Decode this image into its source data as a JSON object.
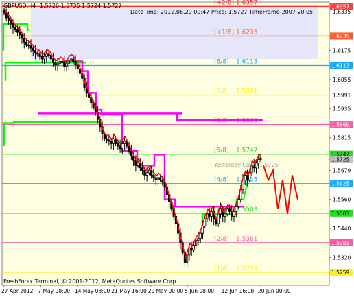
{
  "chart_window": {
    "symbol_label": "GBPUSD,H4",
    "ohlc_values": "1.5726 1.5735 1.5724 1.5727",
    "info_line": "DateTime: 2012.06.20 09:47  Price: 1.5727  TimeFrame-2007-v0.05",
    "copyright": "FreshForex Terminal, © 2001-2012, MetaQuotes Software Corp.",
    "yesterday_close_label": "Yesterday Close 1.5725",
    "colors": {
      "background": "#fefee0",
      "candles": "#000000",
      "red_line": "#ff0000",
      "magenta_line": "#ff00ff",
      "green_line": "#00ff00",
      "lavender_zone": "#e6e6fa"
    }
  },
  "chart_data": {
    "type": "candlestick",
    "symbol": "GBPUSD",
    "timeframe": "H4",
    "ylim": [
      1.5205,
      1.6375
    ],
    "y_ticks": [
      "1.6335",
      "1.6235",
      "1.6175",
      "1.6113",
      "1.6055",
      "1.5991",
      "1.5935",
      "1.5869",
      "1.5815",
      "1.5747",
      "1.5725",
      "1.5679",
      "1.5625",
      "1.5560",
      "1.5503",
      "1.5440",
      "1.5381",
      "1.5320",
      "1.5259"
    ],
    "x_ticks": [
      "27 Apr 2012",
      "7 May 00:00",
      "14 May 08:00",
      "21 May 16:00",
      "29 May 00:00",
      "5 Jun 08:00",
      "12 Jun 16:00",
      "20 Jun 00:00"
    ],
    "murrey_levels": [
      {
        "label": "[+2/8]",
        "value": 1.6357,
        "price_text": "1.6357",
        "color": "#ff3030"
      },
      {
        "label": "[+1/8]",
        "value": 1.6235,
        "price_text": "1.6235",
        "color": "#ff6a2a"
      },
      {
        "label": "[8/8]",
        "value": 1.6113,
        "price_text": "1.6113",
        "color": "#1aaaff"
      },
      {
        "label": "[7/8]",
        "value": 1.5991,
        "price_text": "1.5991",
        "color": "#ffee22"
      },
      {
        "label": "[6/8]",
        "value": 1.5869,
        "price_text": "1.5869",
        "color": "#ff5aa8"
      },
      {
        "label": "[5/8]",
        "value": 1.5747,
        "price_text": "1.5747",
        "color": "#22dd22"
      },
      {
        "label": "[4/8]",
        "value": 1.5625,
        "price_text": "1.5625",
        "color": "#1aaaff"
      },
      {
        "label": "[3/8]",
        "value": 1.5503,
        "price_text": "1.5503",
        "color": "#22dd22"
      },
      {
        "label": "[2/8]",
        "value": 1.5381,
        "price_text": "1.5381",
        "color": "#ff5aa8"
      },
      {
        "label": "[1/8]",
        "value": 1.5259,
        "price_text": "1.5259",
        "color": "#ffee22"
      }
    ],
    "price_badges": [
      {
        "value": 1.6357,
        "text": "1.6357",
        "bg": "#ff4040",
        "fg": "#ffffff"
      },
      {
        "value": 1.6235,
        "text": "1.6235",
        "bg": "#ff5a2a",
        "fg": "#ffffff"
      },
      {
        "value": 1.6113,
        "text": "1.6113",
        "bg": "#1aaaff",
        "fg": "#ffffff"
      },
      {
        "value": 1.5869,
        "text": "1.5869",
        "bg": "#ff5aa8",
        "fg": "#ffffff"
      },
      {
        "value": 1.5747,
        "text": "1.5747",
        "bg": "#22dd22",
        "fg": "#000000"
      },
      {
        "value": 1.5725,
        "text": "1.5725",
        "bg": "#c0c0c0",
        "fg": "#000000"
      },
      {
        "value": 1.5625,
        "text": "1.5625",
        "bg": "#1aaaff",
        "fg": "#ffffff"
      },
      {
        "value": 1.5503,
        "text": "1.5503",
        "bg": "#22dd22",
        "fg": "#000000"
      },
      {
        "value": 1.5381,
        "text": "1.5381",
        "bg": "#ff5aa8",
        "fg": "#ffffff"
      },
      {
        "value": 1.5259,
        "text": "1.5259",
        "bg": "#ffee22",
        "fg": "#000000"
      }
    ],
    "closes": [
      1.633,
      1.631,
      1.63,
      1.6285,
      1.627,
      1.626,
      1.625,
      1.624,
      1.6225,
      1.621,
      1.62,
      1.6195,
      1.6185,
      1.6175,
      1.6165,
      1.616,
      1.615,
      1.614,
      1.615,
      1.616,
      1.6155,
      1.614,
      1.6125,
      1.6115,
      1.612,
      1.613,
      1.6125,
      1.611,
      1.612,
      1.6135,
      1.614,
      1.613,
      1.6115,
      1.61,
      1.608,
      1.606,
      1.602,
      1.6,
      1.598,
      1.596,
      1.594,
      1.592,
      1.589,
      1.586,
      1.583,
      1.581,
      1.5805,
      1.58,
      1.579,
      1.581,
      1.579,
      1.578,
      1.577,
      1.579,
      1.58,
      1.578,
      1.576,
      1.574,
      1.572,
      1.57,
      1.571,
      1.569,
      1.568,
      1.566,
      1.567,
      1.568,
      1.566,
      1.565,
      1.564,
      1.565,
      1.564,
      1.563,
      1.561,
      1.558,
      1.555,
      1.552,
      1.549,
      1.546,
      1.542,
      1.538,
      1.534,
      1.53,
      1.533,
      1.536,
      1.535,
      1.537,
      1.539,
      1.54,
      1.542,
      1.545,
      1.548,
      1.55,
      1.549,
      1.551,
      1.548,
      1.546,
      1.55,
      1.552,
      1.549,
      1.55,
      1.552,
      1.551,
      1.549,
      1.551,
      1.553,
      1.556,
      1.56,
      1.564,
      1.566,
      1.564,
      1.567,
      1.57,
      1.569,
      1.571,
      1.5725,
      1.5727
    ],
    "forecast_zigzag": [
      1.57,
      1.564,
      1.568,
      1.552,
      1.564,
      1.55,
      1.566,
      1.556
    ]
  }
}
